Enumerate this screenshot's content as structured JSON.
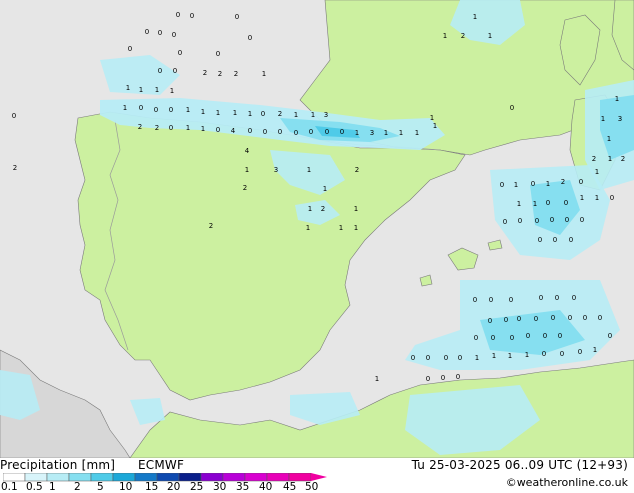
{
  "map": {
    "colors": {
      "sea": "#e6e6e6",
      "land_dry": "#ccf0a0",
      "land_grey": "#d7d7d7",
      "precip_light": "#b7ecf5",
      "precip_medium": "#86dff0",
      "precip_heavy": "#4fcbe8",
      "border": "#9a9a9a",
      "coast": "#7a7a7a"
    },
    "precip_values": [
      {
        "v": "0"
      },
      {
        "v": "0"
      },
      {
        "v": "0"
      },
      {
        "v": "0"
      },
      {
        "v": "0"
      },
      {
        "v": "0"
      },
      {
        "v": "0"
      },
      {
        "v": "0"
      },
      {
        "v": "0"
      },
      {
        "v": "0"
      },
      {
        "v": "0"
      },
      {
        "v": "0"
      },
      {
        "v": "2"
      },
      {
        "v": "2"
      },
      {
        "v": "2"
      },
      {
        "v": "1"
      },
      {
        "v": "1"
      },
      {
        "v": "1"
      },
      {
        "v": "1"
      },
      {
        "v": "1"
      },
      {
        "v": "1"
      },
      {
        "v": "0"
      },
      {
        "v": "0"
      },
      {
        "v": "0"
      },
      {
        "v": "1"
      },
      {
        "v": "1"
      },
      {
        "v": "1"
      },
      {
        "v": "1"
      },
      {
        "v": "1"
      },
      {
        "v": "0"
      },
      {
        "v": "2"
      },
      {
        "v": "1"
      },
      {
        "v": "1"
      },
      {
        "v": "3"
      },
      {
        "v": "2"
      },
      {
        "v": "2"
      },
      {
        "v": "0"
      },
      {
        "v": "1"
      },
      {
        "v": "1"
      },
      {
        "v": "0"
      },
      {
        "v": "4"
      },
      {
        "v": "0"
      },
      {
        "v": "0"
      },
      {
        "v": "0"
      },
      {
        "v": "0"
      },
      {
        "v": "0"
      },
      {
        "v": "0"
      },
      {
        "v": "0"
      },
      {
        "v": "1"
      },
      {
        "v": "3"
      },
      {
        "v": "1"
      },
      {
        "v": "1"
      },
      {
        "v": "1"
      },
      {
        "v": "1"
      },
      {
        "v": "1"
      },
      {
        "v": "4"
      },
      {
        "v": "1"
      },
      {
        "v": "3"
      },
      {
        "v": "1"
      },
      {
        "v": "2"
      },
      {
        "v": "1"
      },
      {
        "v": "2"
      },
      {
        "v": "1"
      },
      {
        "v": "2"
      },
      {
        "v": "1"
      },
      {
        "v": "2"
      },
      {
        "v": "1"
      },
      {
        "v": "1"
      },
      {
        "v": "1"
      },
      {
        "v": "0"
      },
      {
        "v": "2"
      },
      {
        "v": "2"
      },
      {
        "v": "1"
      },
      {
        "v": "1"
      },
      {
        "v": "1"
      },
      {
        "v": "0"
      },
      {
        "v": "1"
      },
      {
        "v": "1"
      },
      {
        "v": "3"
      },
      {
        "v": "1"
      },
      {
        "v": "2"
      },
      {
        "v": "1"
      },
      {
        "v": "2"
      },
      {
        "v": "0"
      },
      {
        "v": "1"
      },
      {
        "v": "0"
      },
      {
        "v": "1"
      },
      {
        "v": "2"
      },
      {
        "v": "0"
      },
      {
        "v": "1"
      },
      {
        "v": "1"
      },
      {
        "v": "1"
      },
      {
        "v": "0"
      },
      {
        "v": "0"
      },
      {
        "v": "1"
      },
      {
        "v": "1"
      },
      {
        "v": "0"
      },
      {
        "v": "0"
      },
      {
        "v": "0"
      },
      {
        "v": "0"
      },
      {
        "v": "0"
      },
      {
        "v": "0"
      },
      {
        "v": "0"
      },
      {
        "v": "0"
      },
      {
        "v": "0"
      },
      {
        "v": "0"
      },
      {
        "v": "0"
      },
      {
        "v": "0"
      },
      {
        "v": "0"
      },
      {
        "v": "0"
      },
      {
        "v": "0"
      },
      {
        "v": "0"
      },
      {
        "v": "0"
      },
      {
        "v": "0"
      },
      {
        "v": "0"
      },
      {
        "v": "0"
      },
      {
        "v": "0"
      },
      {
        "v": "0"
      },
      {
        "v": "0"
      },
      {
        "v": "0"
      },
      {
        "v": "0"
      },
      {
        "v": "0"
      },
      {
        "v": "0"
      },
      {
        "v": "0"
      },
      {
        "v": "0"
      },
      {
        "v": "0"
      },
      {
        "v": "0"
      },
      {
        "v": "0"
      },
      {
        "v": "0"
      },
      {
        "v": "0"
      },
      {
        "v": "0"
      },
      {
        "v": "1"
      },
      {
        "v": "1"
      },
      {
        "v": "1"
      },
      {
        "v": "1"
      },
      {
        "v": "0"
      },
      {
        "v": "0"
      },
      {
        "v": "0"
      },
      {
        "v": "1"
      },
      {
        "v": "1"
      },
      {
        "v": "0"
      },
      {
        "v": "0"
      },
      {
        "v": "0"
      }
    ]
  },
  "footer": {
    "title": "Precipitation [mm]",
    "model": "ECMWF",
    "datetime": "Tu 25-03-2025 06..09 UTC (12+93)",
    "credit": "©weatheronline.co.uk"
  },
  "legend": {
    "ticks": [
      "0.1",
      "0.5",
      "1",
      "2",
      "5",
      "10",
      "15",
      "20",
      "25",
      "30",
      "35",
      "40",
      "45",
      "50"
    ],
    "colors": [
      "#ffffff",
      "#d8f4fa",
      "#b7ecf5",
      "#86dff0",
      "#4fcbe8",
      "#1ca8d8",
      "#1479c8",
      "#0e4ab0",
      "#0a1f8a",
      "#8a00d0",
      "#b800d8",
      "#d800d0",
      "#e800b8",
      "#f000a0"
    ]
  }
}
